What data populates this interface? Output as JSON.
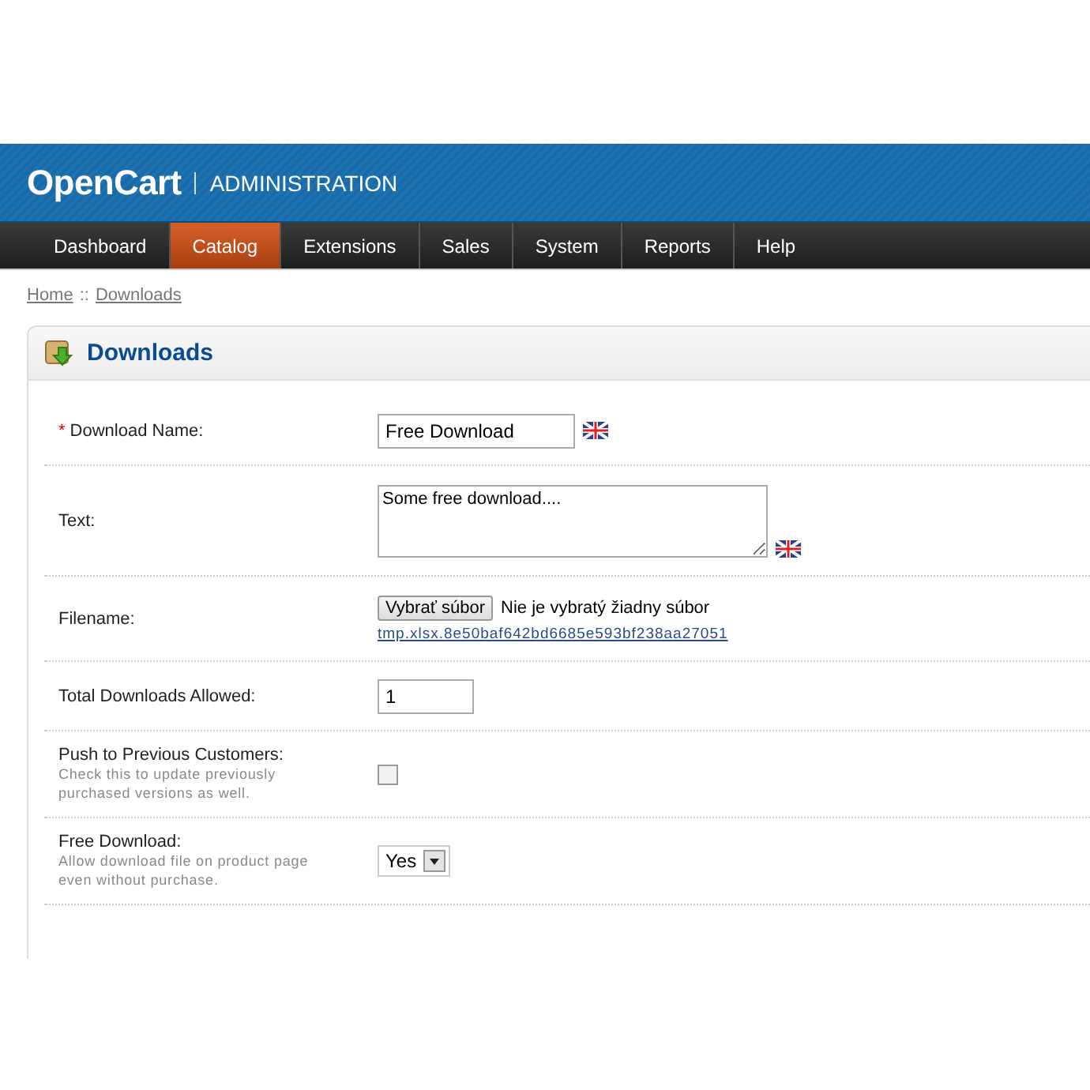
{
  "header": {
    "logo": "OpenCart",
    "subtitle": "ADMINISTRATION"
  },
  "nav": [
    {
      "label": "Dashboard",
      "selected": false
    },
    {
      "label": "Catalog",
      "selected": true
    },
    {
      "label": "Extensions",
      "selected": false
    },
    {
      "label": "Sales",
      "selected": false
    },
    {
      "label": "System",
      "selected": false
    },
    {
      "label": "Reports",
      "selected": false
    },
    {
      "label": "Help",
      "selected": false
    }
  ],
  "breadcrumb": [
    {
      "label": "Home"
    },
    {
      "label": "Downloads"
    }
  ],
  "breadcrumb_separator": "::",
  "panel": {
    "title": "Downloads"
  },
  "form": [
    {
      "kind": "text",
      "required_mark": "*",
      "label": "Download Name:",
      "value": "Free Download",
      "flag": true
    },
    {
      "kind": "textarea",
      "label": "Text:",
      "value": "Some free download....",
      "flag": true
    },
    {
      "kind": "file",
      "label": "Filename:",
      "button": "Vybrať súbor",
      "status": "Nie je vybratý žiadny súbor",
      "link": "tmp.xlsx.8e50baf642bd6685e593bf238aa27051"
    },
    {
      "kind": "number",
      "label": "Total Downloads Allowed:",
      "value": "1"
    },
    {
      "kind": "checkbox",
      "label": "Push to Previous Customers:",
      "help": "Check this to update previously purchased versions as well.",
      "checked": false
    },
    {
      "kind": "select",
      "label": "Free Download:",
      "help": "Allow download file on product page even without purchase.",
      "value": "Yes"
    }
  ]
}
